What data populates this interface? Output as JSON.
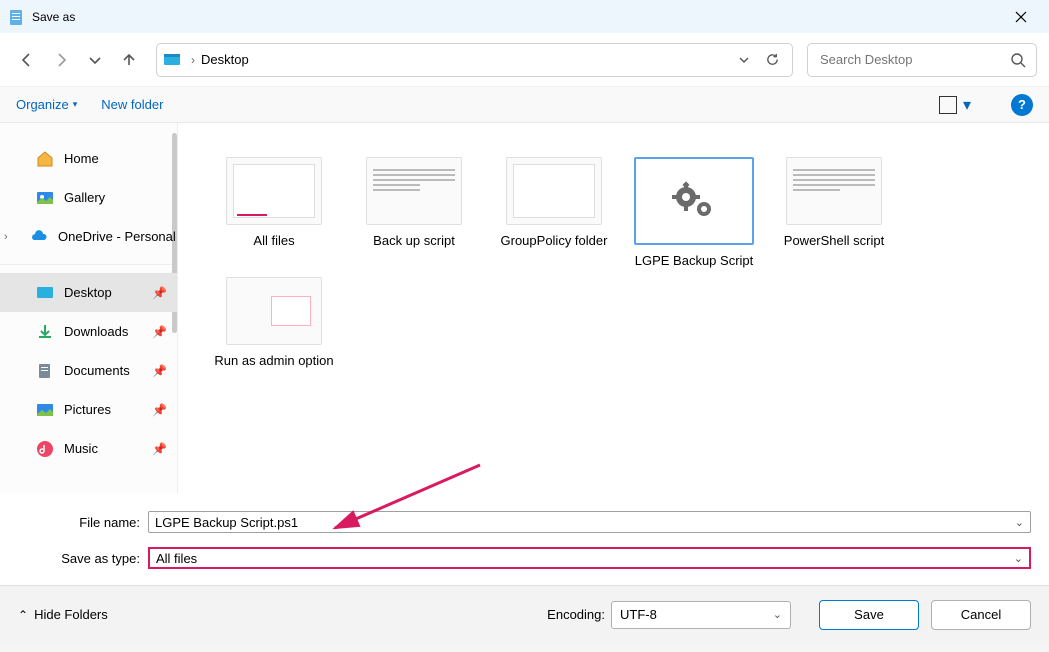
{
  "window": {
    "title": "Save as"
  },
  "nav": {
    "breadcrumb": "Desktop",
    "search_placeholder": "Search Desktop"
  },
  "toolbar": {
    "organize": "Organize",
    "new_folder": "New folder"
  },
  "sidebar": {
    "group1": [
      {
        "label": "Home",
        "icon": "home"
      },
      {
        "label": "Gallery",
        "icon": "gallery"
      },
      {
        "label": "OneDrive - Personal",
        "icon": "onedrive",
        "expandable": true
      }
    ],
    "group2": [
      {
        "label": "Desktop",
        "icon": "desktop",
        "pinned": true,
        "selected": true
      },
      {
        "label": "Downloads",
        "icon": "downloads",
        "pinned": true
      },
      {
        "label": "Documents",
        "icon": "documents",
        "pinned": true
      },
      {
        "label": "Pictures",
        "icon": "pictures",
        "pinned": true
      },
      {
        "label": "Music",
        "icon": "music",
        "pinned": true
      }
    ]
  },
  "files": [
    {
      "label": "All files",
      "kind": "window-thumb"
    },
    {
      "label": "Back up script",
      "kind": "text-thumb"
    },
    {
      "label": "GroupPolicy folder",
      "kind": "folder-thumb"
    },
    {
      "label": "LGPE Backup Script",
      "kind": "gear-thumb",
      "selected": true
    },
    {
      "label": "PowerShell script",
      "kind": "text-thumb"
    },
    {
      "label": "Run as admin option",
      "kind": "desktop-thumb"
    }
  ],
  "form": {
    "file_name_label": "File name:",
    "file_name_value": "LGPE Backup Script.ps1",
    "save_type_label": "Save as type:",
    "save_type_value": "All files"
  },
  "footer": {
    "hide_folders": "Hide Folders",
    "encoding_label": "Encoding:",
    "encoding_value": "UTF-8",
    "save": "Save",
    "cancel": "Cancel"
  }
}
